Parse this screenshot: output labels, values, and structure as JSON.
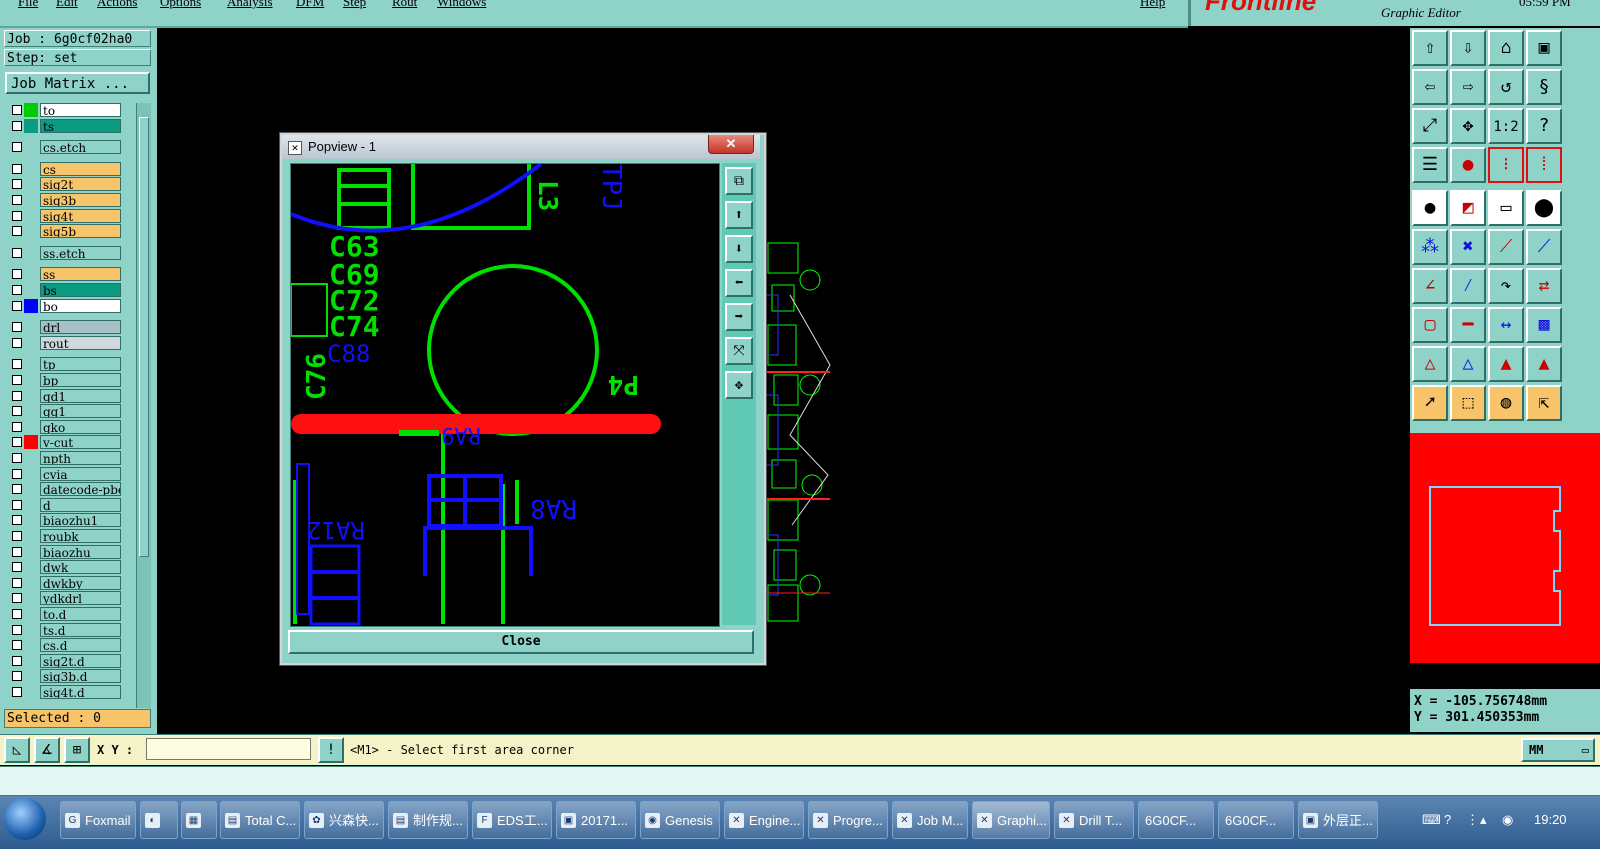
{
  "menubar": {
    "items": [
      "File",
      "Edit",
      "Actions",
      "Options",
      "Analysis",
      "DFM",
      "Step",
      "Rout",
      "Windows"
    ],
    "help": "Help"
  },
  "brand": {
    "logo": "Frontline",
    "subtitle": "Graphic Editor",
    "time": "05:59 PM"
  },
  "job": {
    "job_line": "Job : 6g0cf02ha0",
    "step_line": "Step: set",
    "matrix_button": "Job Matrix ..."
  },
  "layers": [
    {
      "name": "to",
      "color": "#ffffff",
      "swatch": "#00cc00"
    },
    {
      "name": "ts",
      "color": "#0b9b83",
      "swatch": "#0b9b83"
    },
    {
      "name": "cs.etch",
      "color": "#8fd2c8",
      "swatch": "#8fd2c8"
    },
    {
      "name": "cs",
      "color": "#f7c46a",
      "swatch": "#8fd2c8"
    },
    {
      "name": "sig2t",
      "color": "#f7c46a",
      "swatch": "#8fd2c8"
    },
    {
      "name": "sig3b",
      "color": "#f7c46a",
      "swatch": "#8fd2c8"
    },
    {
      "name": "sig4t",
      "color": "#f7c46a",
      "swatch": "#8fd2c8"
    },
    {
      "name": "sig5b",
      "color": "#f7c46a",
      "swatch": "#8fd2c8"
    },
    {
      "name": "ss.etch",
      "color": "#8fd2c8",
      "swatch": "#8fd2c8"
    },
    {
      "name": "ss",
      "color": "#f7c46a",
      "swatch": "#8fd2c8"
    },
    {
      "name": "bs",
      "color": "#0b9b83",
      "swatch": "#8fd2c8"
    },
    {
      "name": "bo",
      "color": "#ffffff",
      "swatch": "#0000ff"
    },
    {
      "name": "drl",
      "color": "#a9bfc7",
      "swatch": "#8fd2c8"
    },
    {
      "name": "rout",
      "color": "#cfd9dc",
      "swatch": "#8fd2c8"
    },
    {
      "name": "tp",
      "color": "#8fd2c8",
      "swatch": "#8fd2c8"
    },
    {
      "name": "bp",
      "color": "#8fd2c8",
      "swatch": "#8fd2c8"
    },
    {
      "name": "gd1",
      "color": "#8fd2c8",
      "swatch": "#8fd2c8"
    },
    {
      "name": "gg1",
      "color": "#8fd2c8",
      "swatch": "#8fd2c8"
    },
    {
      "name": "gko",
      "color": "#8fd2c8",
      "swatch": "#8fd2c8"
    },
    {
      "name": "v-cut",
      "color": "#8fd2c8",
      "swatch": "#ff0000"
    },
    {
      "name": "npth",
      "color": "#8fd2c8",
      "swatch": "#8fd2c8"
    },
    {
      "name": "cvia",
      "color": "#8fd2c8",
      "swatch": "#8fd2c8"
    },
    {
      "name": "datecode-pbe",
      "color": "#8fd2c8",
      "swatch": "#8fd2c8"
    },
    {
      "name": "d",
      "color": "#8fd2c8",
      "swatch": "#8fd2c8"
    },
    {
      "name": "biaozhu1",
      "color": "#8fd2c8",
      "swatch": "#8fd2c8"
    },
    {
      "name": "roubk",
      "color": "#8fd2c8",
      "swatch": "#8fd2c8"
    },
    {
      "name": "biaozhu",
      "color": "#8fd2c8",
      "swatch": "#8fd2c8"
    },
    {
      "name": "dwk",
      "color": "#8fd2c8",
      "swatch": "#8fd2c8"
    },
    {
      "name": "dwkby",
      "color": "#8fd2c8",
      "swatch": "#8fd2c8"
    },
    {
      "name": "ydkdrl",
      "color": "#8fd2c8",
      "swatch": "#8fd2c8"
    },
    {
      "name": "to.d",
      "color": "#8fd2c8",
      "swatch": "#8fd2c8"
    },
    {
      "name": "ts.d",
      "color": "#8fd2c8",
      "swatch": "#8fd2c8"
    },
    {
      "name": "cs.d",
      "color": "#8fd2c8",
      "swatch": "#8fd2c8"
    },
    {
      "name": "sig2t.d",
      "color": "#8fd2c8",
      "swatch": "#8fd2c8"
    },
    {
      "name": "sig3b.d",
      "color": "#8fd2c8",
      "swatch": "#8fd2c8"
    },
    {
      "name": "sig4t.d",
      "color": "#8fd2c8",
      "swatch": "#8fd2c8"
    }
  ],
  "selected": "Selected : 0",
  "popview": {
    "title": "Popview - 1",
    "close_button": "Close",
    "labels": [
      "C63",
      "C69",
      "C72",
      "C74",
      "C76",
      "P4",
      "L3",
      "RA8",
      "RA9",
      "RA12",
      "C88",
      "TPJ"
    ]
  },
  "coords": {
    "x": "X = -105.756748mm",
    "y": "Y = 301.450353mm"
  },
  "command": {
    "xy_label": "X Y :",
    "xy_value": "",
    "bang": "!",
    "prompt": "<M1> - Select first area corner",
    "units": "MM"
  },
  "taskbar": {
    "items": [
      "Foxmail",
      "",
      "",
      "Total C...",
      "兴森快...",
      "制作规...",
      "EDS工...",
      "20171...",
      "Genesis",
      "Engine...",
      "Progre...",
      "Job M...",
      "Graphi...",
      "Drill T...",
      "6G0CF...",
      "6G0CF...",
      "外层正..."
    ],
    "clock": "19:20"
  },
  "icons": {
    "close": "close-icon",
    "start": "windows-start-icon"
  }
}
